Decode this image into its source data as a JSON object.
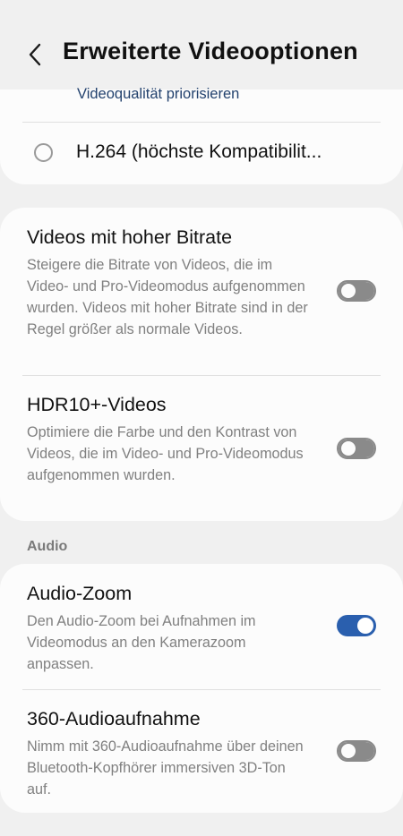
{
  "header": {
    "title": "Erweiterte Videooptionen",
    "back_icon": "chevron-left-icon"
  },
  "codec": {
    "selected_subtitle": "Videoqualität priorisieren",
    "option_label": "H.264 (höchste Kompatibilit...",
    "option_selected": false
  },
  "video": {
    "high_bitrate": {
      "title": "Videos mit hoher Bitrate",
      "description": "Steigere die Bitrate von Videos, die im Video- und Pro-Videomodus aufgenommen wurden. Videos mit hoher Bitrate sind in der Regel größer als normale Videos.",
      "enabled": false
    },
    "hdr10": {
      "title": "HDR10+-Videos",
      "description": "Optimiere die Farbe und den Kontrast von Videos, die im Video- und Pro-Videomodus aufgenommen wurden.",
      "enabled": false
    }
  },
  "audio": {
    "section_label": "Audio",
    "audio_zoom": {
      "title": "Audio-Zoom",
      "description": "Den Audio-Zoom bei Aufnahmen im Videomodus an den Kamerazoom anpassen.",
      "enabled": true
    },
    "audio_360": {
      "title": "360-Audioaufnahme",
      "description": "Nimm mit 360-Audioaufnahme über deinen Bluetooth-Kopfhörer immersiven 3D-Ton auf.",
      "enabled": false
    }
  },
  "colors": {
    "accent": "#2a5fae",
    "background": "#f0f0f0",
    "card": "#fcfcfc",
    "toggle_off": "#8a8a8a",
    "secondary_text": "#808080"
  }
}
